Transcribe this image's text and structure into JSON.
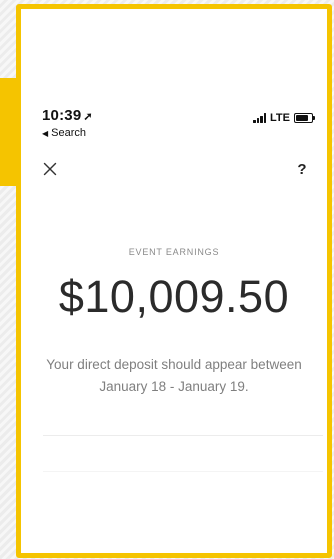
{
  "status_bar": {
    "time": "10:39",
    "location_arrow": "➚",
    "back_glyph": "◀",
    "back_label": "Search",
    "network": "LTE",
    "battery_level": 0.8
  },
  "header": {
    "close_glyph": "X",
    "help_label": "?"
  },
  "earnings": {
    "label": "EVENT EARNINGS",
    "amount": "$10,009.50",
    "deposit_line1": "Your direct deposit should appear between",
    "deposit_line2": "January 18 - January 19."
  },
  "colors": {
    "frame_accent": "#f5c400",
    "text_primary": "#2b2b2b",
    "text_secondary": "#7f7f7f"
  }
}
